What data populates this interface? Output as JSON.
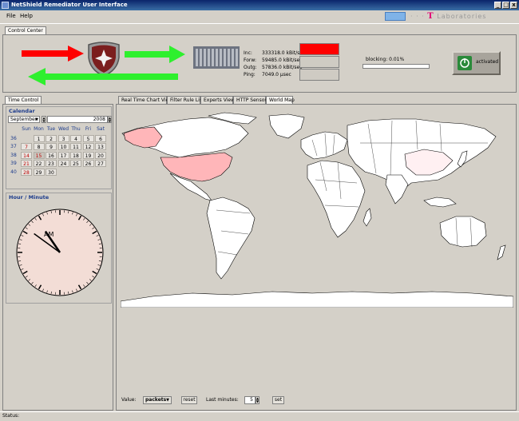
{
  "window": {
    "title": "NetShield Remediator User Interface"
  },
  "menu": {
    "file": "File",
    "help": "Help"
  },
  "brand": {
    "text": "Laboratories",
    "t_letter": "T",
    "dots": "· · ·"
  },
  "top_tab": "Control Center",
  "stats": {
    "inc": "Inc:",
    "inc_val": "333318.0 kBit/sec",
    "forw": "Forw:",
    "forw_val": "59485.0 kBit/sec",
    "outg": "Outg:",
    "outg_val": "57836.0 kBit/sec",
    "ping": "Ping:",
    "ping_val": "7049.0 µsec"
  },
  "blocking": {
    "label": "blocking: 0.01%",
    "fraction": 0.0001
  },
  "activated_label": "activated",
  "time_control_tab": "Time Control",
  "calendar": {
    "title": "Calendar",
    "month": "September",
    "year": "2008",
    "days": [
      "Sun",
      "Mon",
      "Tue",
      "Wed",
      "Thu",
      "Fri",
      "Sat"
    ],
    "weeks": [
      {
        "wk": "36",
        "days": [
          "",
          "1",
          "2",
          "3",
          "4",
          "5",
          "6"
        ]
      },
      {
        "wk": "37",
        "days": [
          "7",
          "8",
          "9",
          "10",
          "11",
          "12",
          "13"
        ]
      },
      {
        "wk": "38",
        "days": [
          "14",
          "15",
          "16",
          "17",
          "18",
          "19",
          "20"
        ]
      },
      {
        "wk": "39",
        "days": [
          "21",
          "22",
          "23",
          "24",
          "25",
          "26",
          "27"
        ]
      },
      {
        "wk": "40",
        "days": [
          "28",
          "29",
          "30",
          "",
          "",
          "",
          ""
        ]
      }
    ],
    "selected": "15"
  },
  "clock": {
    "title": "Hour / Minute",
    "am_label": "AM",
    "hour": 10,
    "minute": 51
  },
  "view_tabs": [
    "Real Time Chart View",
    "Filter Rule List",
    "Experts View",
    "HTTP Sensors",
    "World Map"
  ],
  "active_view_tab": 4,
  "bottom": {
    "value_label": "Value:",
    "value_select": "packets",
    "reset": "reset",
    "last_minutes_label": "Last minutes:",
    "last_minutes_value": "5",
    "set": "set"
  },
  "status": "Status:",
  "colors": {
    "accent": "#1c3b8c",
    "highlight_red": "#ff0000",
    "us_fill": "#ffb6b9",
    "activated_green": "#2a8a3a"
  }
}
